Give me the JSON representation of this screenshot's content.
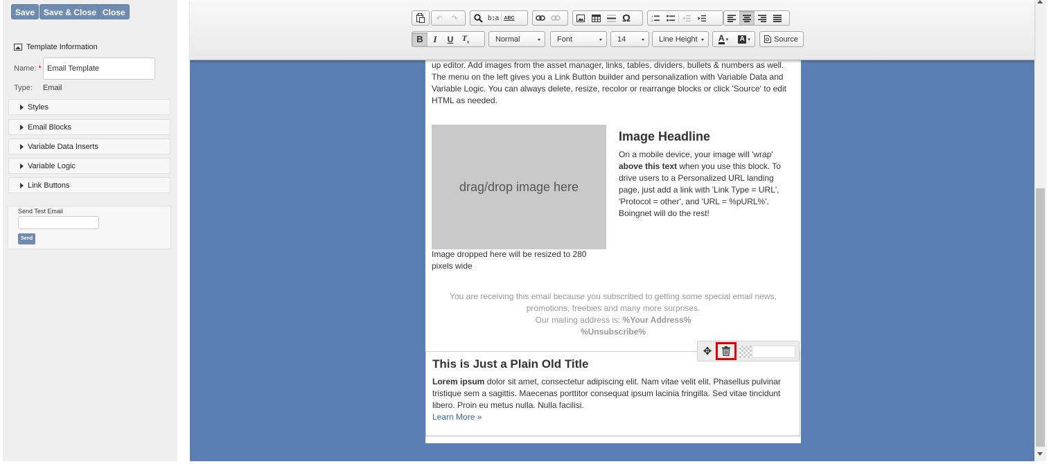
{
  "top_buttons": {
    "save": "Save",
    "save_close": "Save & Close",
    "close": "Close"
  },
  "template_info": {
    "header": "Template Information",
    "name_label": "Name:",
    "required_mark": "*",
    "name_value": "Email Template",
    "type_label": "Type:",
    "type_value": "Email"
  },
  "accordion": [
    "Styles",
    "Email Blocks",
    "Variable Data Inserts",
    "Variable Logic",
    "Link Buttons"
  ],
  "send_test": {
    "label": "Send Test Email",
    "button": "Send"
  },
  "toolbar": {
    "format": "Normal",
    "font": "Font",
    "size": "14",
    "line_height": "Line Height",
    "source": "Source",
    "bold": "B",
    "italic": "I",
    "underline": "U",
    "omega": "Ω",
    "abc": "ABC"
  },
  "email": {
    "intro": "up editor. Add images from the asset manager, links, tables, dividers, bullets & numbers as well. The menu on the left gives you a Link Button builder and personalization with Variable Data and Variable Logic. You can always delete, resize, recolor or rearrange blocks or click 'Source' to edit HTML as needed.",
    "image_placeholder": "drag/drop image here",
    "image_caption": "Image dropped here will be resized to 280 pixels wide",
    "headline": "Image Headline",
    "headline_body_1": "On a mobile device, your image will 'wrap'",
    "headline_bold": "above this text",
    "headline_body_2": "when you use this block. To drive users to a Personalized URL landing page, just add a link with 'Link Type = URL', 'Protocol = other', and 'URL = %pURL%'. Boingnet will do the rest!",
    "footer_line": "You are receiving this email because you subscribed to getting some special email news, promotions, freebies and many more surprises.",
    "footer_address_label": "Our mailing address is:",
    "footer_address": "%Your Address%",
    "footer_unsubscribe": "%Unsubscribe%",
    "plain_title": "This is Just a Plain Old Title",
    "plain_bold": "Lorem ipsum",
    "plain_body": "dolor sit amet, consectetur adipiscing elit. Nam vitae velit elit. Phasellus pulvinar tristique sem a sagittis. Maecenas porttitor consequat ipsum lacinia fringilla. Sed vitae tincidunt libero. Proin eu metus nulla. Nulla facilisi.",
    "learn_more": "Learn More »"
  },
  "colors": {
    "editor_bg": "#5b7fb5",
    "button_bg": "#6f8bb0",
    "highlight": "#e00000"
  }
}
